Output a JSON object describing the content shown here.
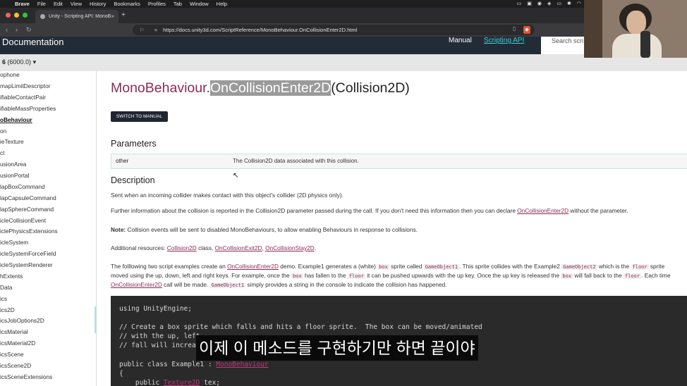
{
  "menubar": {
    "app": "Brave",
    "items": [
      "File",
      "Edit",
      "View",
      "History",
      "Bookmarks",
      "Profiles",
      "Tab",
      "Window",
      "Help"
    ]
  },
  "tabbar": {
    "tab_title": "Unity - Scripting API: MonoB"
  },
  "addressbar": {
    "url": "https://docs.unity3d.com/ScriptReference/MonoBehaviour.OnCollisionEnter2D.html"
  },
  "header": {
    "title": "Documentation",
    "manual": "Manual",
    "scripting_api": "Scripting API",
    "search_placeholder": "Search scri"
  },
  "version": {
    "major": "6",
    "full": "(6000.0)"
  },
  "sidebar": {
    "items": [
      "ophone",
      "mapLimitDescriptor",
      "ifiableContactPair",
      "ifiableMassProperties",
      "oBehaviour",
      "on",
      "ieTexture",
      "ct",
      "usionArea",
      "usionPortal",
      "lapBoxCommand",
      "lapCapsuleCommand",
      "lapSphereCommand",
      "icleCollisionEvent",
      "iclePhysicsExtensions",
      "icleSystem",
      "icleSystemForceField",
      "icleSystemRenderer",
      "hExtents",
      "Data",
      "ics",
      "ics2D",
      "icsJobOptions2D",
      "icsMaterial",
      "icsMaterial2D",
      "icsScene",
      "icsScene2D",
      "icsSceneExtensions"
    ]
  },
  "page": {
    "title_class": "MonoBehaviour",
    "title_dot": ".",
    "title_method": "OnCollisionEnter2D",
    "title_args": "(Collision2D)",
    "switch_button": "SWITCH TO MANUAL",
    "parameters_heading": "Parameters",
    "param_name": "other",
    "param_desc": "The Collision2D data associated with this collision.",
    "description_heading": "Description",
    "desc1": "Sent when an incoming collider makes contact with this object's collider (2D physics only).",
    "desc2_pre": "Further information about the collision is reported in the Collision2D parameter passed during the call. If you don't need this information then you can declare ",
    "desc2_link": "OnCollisionEnter2D",
    "desc2_post": " without the parameter.",
    "note_label": "Note:",
    "note_text": " Collision events will be sent to disabled MonoBehaviours, to allow enabling Behaviours in response to collisions.",
    "res_pre": "Additional resources: ",
    "res_link1": "Collision2D",
    "res_mid1": " class, ",
    "res_link2": "OnCollisionExit2D",
    "res_mid2": ", ",
    "res_link3": "OnCollisionStay2D",
    "res_end": ".",
    "ex_a": "The folllowing two script examples create an ",
    "ex_link1": "OnCollisionEnter2D",
    "ex_b": " demo. Example1 generates a (white) ",
    "ex_code_box": "box",
    "ex_c": " sprite called ",
    "ex_code_go1": "GameObject1",
    "ex_d": ". This sprite collides with the Example2 ",
    "ex_code_go2": "GameObject2",
    "ex_e": " which is the ",
    "ex_code_floor": "floor",
    "ex_f": " sprite",
    "ex2_a": "moved using the up, down, left and right keys. For example, once the ",
    "ex2_box": "box",
    "ex2_b": " has fallen to the ",
    "ex2_floor": "floor",
    "ex2_c": " it can be pushed upwards with the up key. Once the up key is released the ",
    "ex2_box2": "box",
    "ex2_d": " will fall back to the ",
    "ex2_floor2": "floor",
    "ex2_e": ". Each time",
    "ex3_link": "OnCollisionEnter2D",
    "ex3_a": " call will be made. ",
    "ex3_code": "GameObject1",
    "ex3_b": " simply provides a string in the console to indicate the collision has happened.",
    "code_line1": "using UnityEngine;",
    "code_line2": "// Create a box sprite which falls and hits a floor sprite.  The box can be moved/animated",
    "code_line3": "// with the up, left",
    "code_line4": "// fall will increas",
    "code_line5_a": "public class Example1 : ",
    "code_line5_type": "MonoBehaviour",
    "code_line6": "{",
    "code_line7_a": "    public ",
    "code_line7_type": "Texture2D",
    "code_line7_b": " tex;"
  },
  "subtitle": "이제 이 메소드를 구현하기만 하면 끝이야"
}
